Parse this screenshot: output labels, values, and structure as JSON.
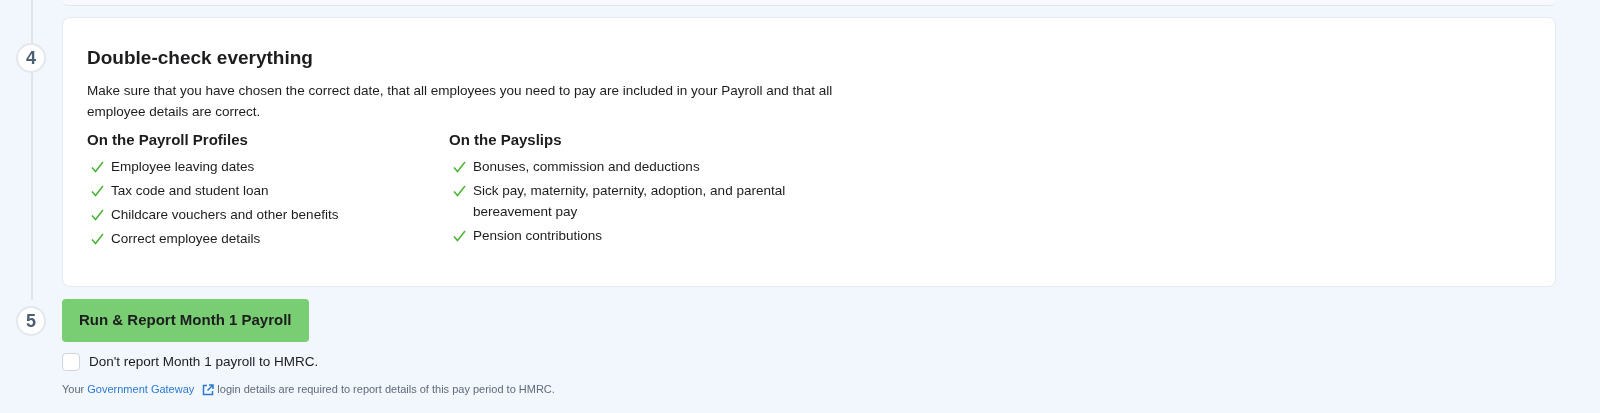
{
  "steps": [
    {
      "number": "4",
      "title": "Double-check everything",
      "description": "Make sure that you have chosen the correct date, that all employees you need to pay are included in your Payroll and that all employee details are correct.",
      "columns": [
        {
          "heading": "On the Payroll Profiles",
          "items": [
            "Employee leaving dates",
            "Tax code and student loan",
            "Childcare vouchers and other benefits",
            "Correct employee details"
          ]
        },
        {
          "heading": "On the Payslips",
          "items": [
            "Bonuses, commission and deductions",
            "Sick pay, maternity, paternity, adoption, and parental bereavement pay",
            "Pension contributions"
          ]
        }
      ]
    },
    {
      "number": "5",
      "button": "Run & Report Month 1 Payroll",
      "checkbox": {
        "label": "Don't report Month 1 payroll to HMRC.",
        "checked": false
      },
      "note": {
        "before": "Your",
        "link": "Government Gateway",
        "after": "login details are required to report details of this pay period to HMRC."
      }
    }
  ]
}
